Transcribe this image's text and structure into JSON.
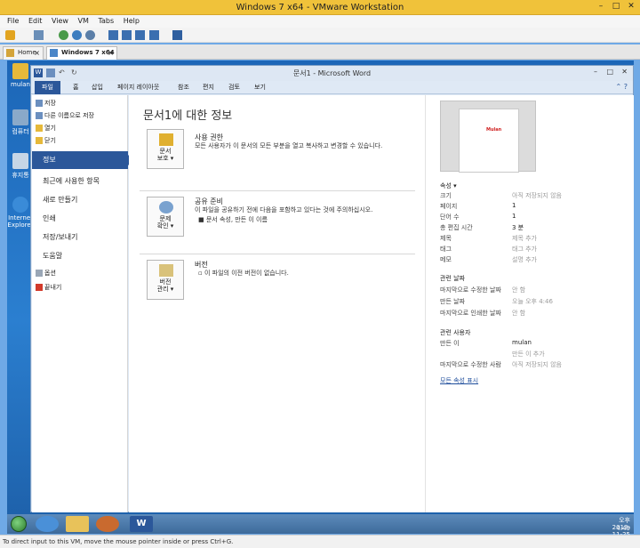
{
  "vm": {
    "title": "Windows 7 x64 - VMware Workstation",
    "menu": [
      "File",
      "Edit",
      "View",
      "VM",
      "Tabs",
      "Help"
    ],
    "tabs": [
      {
        "label": "Home"
      },
      {
        "label": "Windows 7 x64",
        "active": true
      }
    ],
    "status": "To direct input to this VM, move the mouse pointer inside or press Ctrl+G."
  },
  "desktop": {
    "icons": [
      {
        "label": "mulan",
        "icon": "user-folder-icon"
      },
      {
        "label": "컴퓨터",
        "icon": "computer-icon"
      },
      {
        "label": "휴지통",
        "icon": "recycle-bin-icon"
      },
      {
        "label": "Internet Explorer",
        "icon": "ie-icon"
      }
    ]
  },
  "word": {
    "title": "문서1 - Microsoft Word",
    "tabs": [
      "파일",
      "홈",
      "삽입",
      "페이지 레이아웃",
      "참조",
      "편지",
      "검토",
      "보기"
    ],
    "nav_small_top": [
      "저장",
      "다른 이름으로 저장",
      "열기",
      "닫기"
    ],
    "nav_active": "정보",
    "nav_big": [
      "최근에 사용한 항목",
      "새로 만들기",
      "인쇄",
      "저장/보내기",
      "도움말"
    ],
    "nav_small_bottom": [
      "옵션",
      "끝내기"
    ],
    "info_title": "문서1에 대한 정보",
    "sections": [
      {
        "button": [
          "문서",
          "보호 ▾"
        ],
        "heading": "사용 권한",
        "text": "모든 사용자가 이 문서의 모든 부분을 열고 복사하고 변경할 수 있습니다.",
        "bullets": []
      },
      {
        "button": [
          "문제",
          "확인 ▾"
        ],
        "heading": "공유 준비",
        "text": "이 파일을 공유하기 전에 다음을 포함하고 있다는 것에 주의하십시오.",
        "bullets": [
          "문서 속성, 만든 이 이름"
        ]
      },
      {
        "button": [
          "버전",
          "관리 ▾"
        ],
        "heading": "버전",
        "text": "",
        "bullets": [
          "이 파일의 이전 버전이 없습니다."
        ]
      }
    ],
    "thumbnail_text": "Mulan",
    "props": {
      "heading": "속성 ▾",
      "rows": [
        {
          "k": "크기",
          "v": "아직 저장되지 않음",
          "muted": true
        },
        {
          "k": "페이지",
          "v": "1",
          "muted": false
        },
        {
          "k": "단어 수",
          "v": "1",
          "muted": false
        },
        {
          "k": "총 편집 시간",
          "v": "3 분",
          "muted": false
        },
        {
          "k": "제목",
          "v": "제목 추가",
          "muted": true
        },
        {
          "k": "태그",
          "v": "태그 추가",
          "muted": true
        },
        {
          "k": "메모",
          "v": "설명 추가",
          "muted": true
        }
      ],
      "dates_heading": "관련 날짜",
      "dates": [
        {
          "k": "마지막으로 수정한 날짜",
          "v": "안 함",
          "muted": true
        },
        {
          "k": "만든 날짜",
          "v": "오늘 오후 4:46",
          "muted": true
        },
        {
          "k": "마지막으로 인쇄한 날짜",
          "v": "안 함",
          "muted": true
        }
      ],
      "people_heading": "관련 사용자",
      "people": [
        {
          "k": "만든 이",
          "v": "mulan",
          "muted": false
        },
        {
          "k": "",
          "v": "만든 이 추가",
          "muted": true
        },
        {
          "k": "마지막으로 수정한 사람",
          "v": "아직 저장되지 않음",
          "muted": true
        }
      ],
      "all_props_link": "모든 속성 표시"
    }
  },
  "taskbar": {
    "time": "오후 4:49",
    "date": "2013-11-25"
  }
}
